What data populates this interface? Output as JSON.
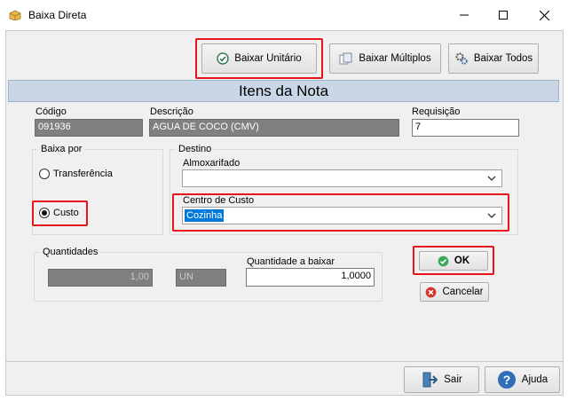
{
  "window": {
    "title": "Baixa Direta"
  },
  "toolbar": {
    "baixar_unitario": "Baixar Unitário",
    "baixar_multiplos": "Baixar Múltiplos",
    "baixar_todos": "Baixar Todos"
  },
  "header": {
    "title": "Itens da Nota"
  },
  "fields": {
    "codigo_label": "Código",
    "codigo_value": "091936",
    "descricao_label": "Descrição",
    "descricao_value": "AGUA DE COCO (CMV)",
    "requisicao_label": "Requisição",
    "requisicao_value": "7"
  },
  "baixa_por": {
    "title": "Baixa por",
    "options": [
      "Transferência",
      "Custo"
    ],
    "selected": "Custo"
  },
  "destino": {
    "title": "Destino",
    "almoxarifado_label": "Almoxarifado",
    "almoxarifado_value": "",
    "centro_label": "Centro de Custo",
    "centro_value": "Cozinha"
  },
  "quantidades": {
    "title": "Quantidades",
    "qty_value": "1,00",
    "unit_value": "UN",
    "baixar_label": "Quantidade a baixar",
    "baixar_value": "1,0000"
  },
  "actions": {
    "ok": "OK",
    "cancelar": "Cancelar"
  },
  "footer": {
    "sair": "Sair",
    "ajuda": "Ajuda"
  }
}
